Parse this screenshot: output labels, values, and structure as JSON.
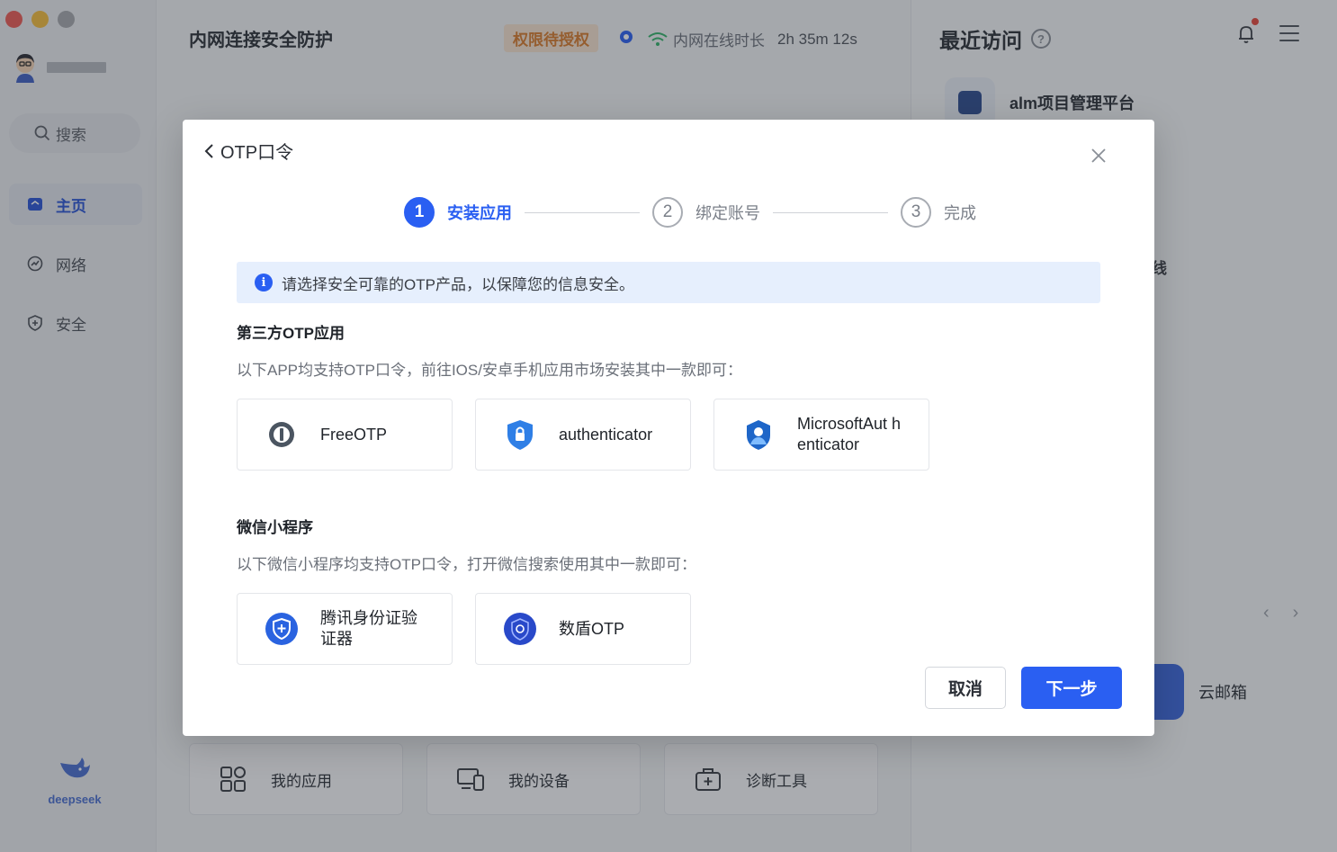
{
  "sidebar": {
    "search_label": "搜索",
    "nav": [
      {
        "label": "主页",
        "icon": "home-icon",
        "active": true
      },
      {
        "label": "网络",
        "icon": "network-icon",
        "active": false
      },
      {
        "label": "安全",
        "icon": "shield-icon",
        "active": false
      }
    ],
    "brand": "deepseek"
  },
  "header": {
    "title": "内网连接安全防护",
    "permission_badge": "权限待授权",
    "online_label": "内网在线时长",
    "online_time": "2h 35m 12s"
  },
  "recent": {
    "title": "最近访问",
    "items": [
      {
        "label": "alm项目管理平台"
      }
    ],
    "partial_char": "线",
    "mail_label": "云邮箱"
  },
  "tools": [
    {
      "label": "我的应用",
      "icon": "apps-grid-icon"
    },
    {
      "label": "我的设备",
      "icon": "devices-icon"
    },
    {
      "label": "诊断工具",
      "icon": "toolbox-icon"
    }
  ],
  "modal": {
    "title": "OTP口令",
    "steps": [
      {
        "num": "1",
        "label": "安装应用",
        "active": true
      },
      {
        "num": "2",
        "label": "绑定账号",
        "active": false
      },
      {
        "num": "3",
        "label": "完成",
        "active": false
      }
    ],
    "info": "请选择安全可靠的OTP产品，以保障您的信息安全。",
    "third_party": {
      "title": "第三方OTP应用",
      "desc": "以下APP均支持OTP口令，前往IOS/安卓手机应用市场安装其中一款即可：",
      "apps": [
        {
          "name": "FreeOTP",
          "icon": "freeotp-icon"
        },
        {
          "name": "authenticator",
          "icon": "authenticator-shield-icon"
        },
        {
          "name": "MicrosoftAut henticator",
          "icon": "microsoft-authenticator-icon"
        }
      ]
    },
    "wechat": {
      "title": "微信小程序",
      "desc": "以下微信小程序均支持OTP口令，打开微信搜索使用其中一款即可：",
      "apps": [
        {
          "name": "腾讯身份证验证器",
          "icon": "tencent-shield-icon"
        },
        {
          "name": "数盾OTP",
          "icon": "shudun-icon"
        }
      ]
    },
    "cancel_label": "取消",
    "next_label": "下一步"
  },
  "colors": {
    "accent": "#2a5ff2",
    "badge_text": "#d97b2c",
    "badge_bg": "#f7e3cf"
  }
}
